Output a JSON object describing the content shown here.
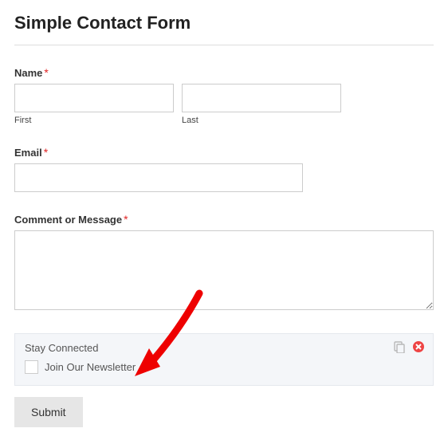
{
  "form": {
    "title": "Simple Contact Form",
    "name": {
      "label": "Name",
      "first_sublabel": "First",
      "last_sublabel": "Last"
    },
    "email": {
      "label": "Email"
    },
    "comment": {
      "label": "Comment or Message"
    },
    "stay_connected": {
      "title": "Stay Connected",
      "checkbox_label": "Join Our Newsletter"
    },
    "submit_label": "Submit",
    "required_marker": "*"
  }
}
